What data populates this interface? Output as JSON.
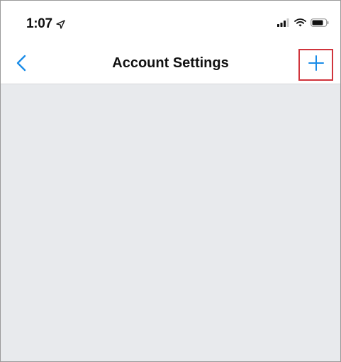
{
  "status_bar": {
    "time": "1:07",
    "icons": [
      "location-arrow-icon",
      "signal-icon",
      "wifi-icon",
      "battery-icon"
    ]
  },
  "nav_bar": {
    "title": "Account Settings",
    "back_icon": "chevron-left-icon",
    "add_icon": "plus-icon"
  },
  "colors": {
    "accent": "#1a8ce8",
    "highlight_border": "#d0343c",
    "content_background": "#e8eaed",
    "text": "#111111"
  }
}
